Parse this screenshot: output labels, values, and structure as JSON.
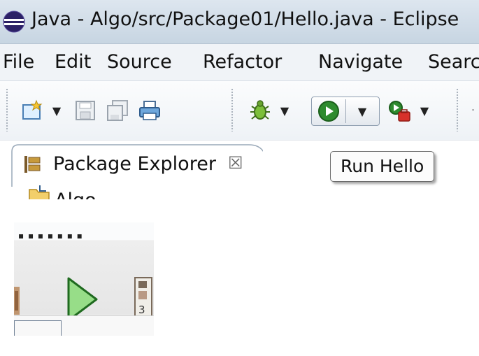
{
  "window": {
    "title": "Java - Algo/src/Package01/Hello.java - Eclipse"
  },
  "menu": {
    "items": [
      "File",
      "Edit",
      "Source",
      "Refactor",
      "Navigate",
      "Searc"
    ]
  },
  "toolbar": {
    "icons": {
      "new": "new-file-icon",
      "save": "save-icon",
      "save_all": "save-all-icon",
      "print": "print-icon",
      "debug": "debug-icon",
      "run": "run-icon",
      "external_tools": "external-tools-icon"
    },
    "dropdown_glyph": "▼"
  },
  "views": {
    "package_explorer": {
      "tab_label": "Package Explorer",
      "close_glyph": "☒",
      "tree": [
        {
          "label": "Algo",
          "icon": "project-folder-icon"
        }
      ]
    }
  },
  "tooltip": {
    "text": "Run Hello"
  },
  "zoom_inset": {
    "digit": "3"
  },
  "colors": {
    "run_green": "#2e8b2e",
    "play_outline": "#1f6a1f",
    "play_fill": "#97dd88"
  }
}
